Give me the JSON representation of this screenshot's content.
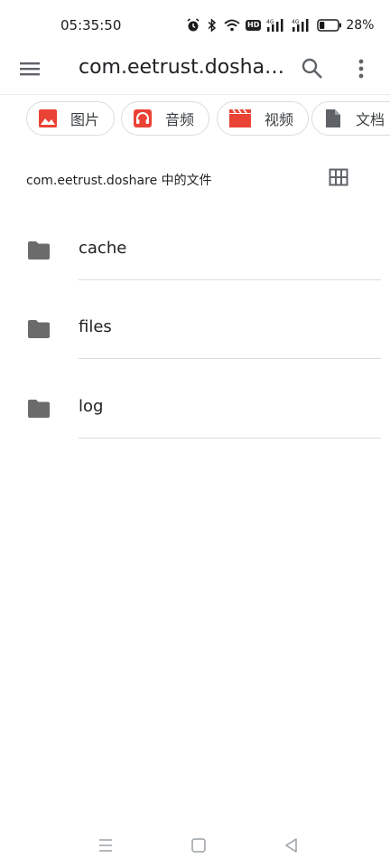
{
  "status": {
    "time": "05:35:50",
    "hd_label": "HD",
    "network_1": "4G",
    "network_2": "4G",
    "battery": "28%",
    "battery_level": 0.28
  },
  "app_bar": {
    "title": "com.eetrust.dosha…"
  },
  "chips": [
    {
      "label": "图片",
      "icon": "image-icon",
      "color": "#ea4335"
    },
    {
      "label": "音频",
      "icon": "headphones-icon",
      "color": "#ea4335"
    },
    {
      "label": "视频",
      "icon": "movie-icon",
      "color": "#ea4335"
    },
    {
      "label": "文档",
      "icon": "document-icon",
      "color": "#5f6368"
    }
  ],
  "section": {
    "header": "com.eetrust.doshare 中的文件"
  },
  "files": [
    {
      "name": "cache"
    },
    {
      "name": "files"
    },
    {
      "name": "log"
    }
  ],
  "colors": {
    "folder": "#6b6b6b",
    "accent_red": "#ea4335"
  }
}
